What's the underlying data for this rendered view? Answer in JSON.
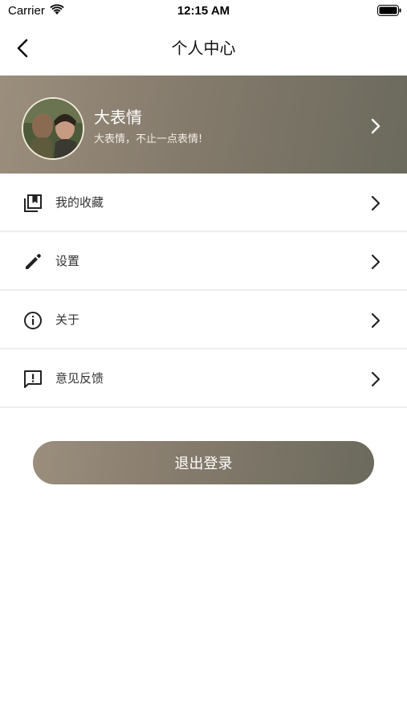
{
  "status_bar": {
    "carrier": "Carrier",
    "time": "12:15 AM"
  },
  "nav": {
    "title": "个人中心",
    "back_icon": "chevron-left-icon"
  },
  "profile": {
    "name": "大表情",
    "bio": "大表情，不止一点表情!",
    "gradient_start": "#9b8e7d",
    "gradient_end": "#6b6a5d"
  },
  "menu": {
    "items": [
      {
        "label": "我的收藏",
        "icon": "bookmark-collection-icon"
      },
      {
        "label": "设置",
        "icon": "pencil-icon"
      },
      {
        "label": "关于",
        "icon": "info-icon"
      },
      {
        "label": "意见反馈",
        "icon": "feedback-icon"
      }
    ]
  },
  "logout": {
    "label": "退出登录"
  }
}
